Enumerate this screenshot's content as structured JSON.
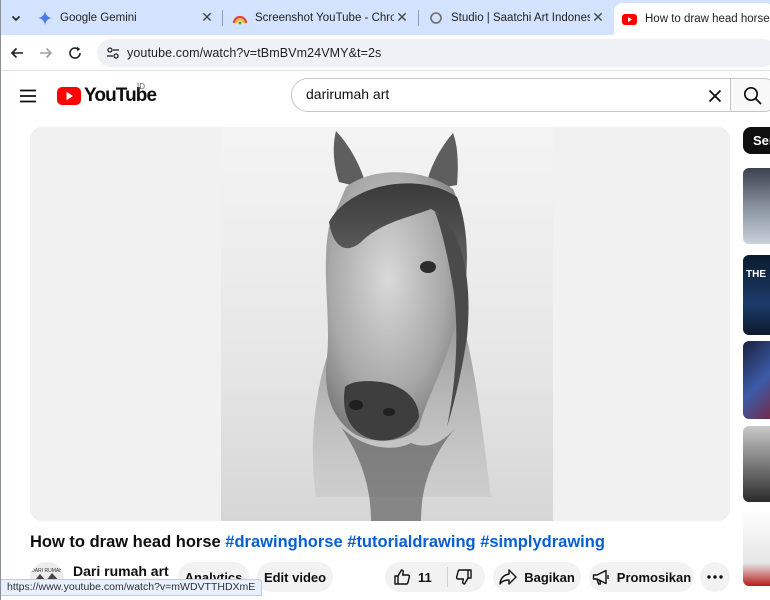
{
  "browser": {
    "tabs": [
      {
        "title": "Google Gemini",
        "icon": "gemini-sparkle-icon"
      },
      {
        "title": "Screenshot YouTube - Chrome",
        "icon": "chrome-web-store-icon"
      },
      {
        "title": "Studio | Saatchi Art Indonesia",
        "icon": "loading-ring-icon"
      },
      {
        "title": "How to draw head horse #drawinghorse",
        "icon": "youtube-icon"
      }
    ],
    "url": "youtube.com/watch?v=tBmBVm24VMY&t=2s",
    "status_url": "https://www.youtube.com/watch?v=mWDVTTHDXmE"
  },
  "youtube": {
    "logo_text": "YouTube",
    "country_code": "ID",
    "search_query": "darirumah art",
    "chip_label": "Ser",
    "video": {
      "title_main": "How to draw head horse",
      "hashtags": [
        "#drawinghorse",
        "#tutorialdrawing",
        "#simplydrawing"
      ],
      "channel_name": "Dari rumah art",
      "avatar_text": "DARI RUMAH",
      "buttons": {
        "analytics": "Analytics",
        "edit_video": "Edit video",
        "like_count": "11",
        "share": "Bagikan",
        "promote": "Promosikan"
      }
    },
    "sidebar_thumbs": [
      {
        "text": ""
      },
      {
        "text": "THE"
      },
      {
        "text": ""
      },
      {
        "text": ""
      },
      {
        "text": ""
      }
    ]
  },
  "colors": {
    "tab_strip": "#d3e3fd",
    "youtube_red": "#ff0000",
    "hashtag_blue": "#065fd4",
    "pill_bg": "#f2f2f2"
  }
}
